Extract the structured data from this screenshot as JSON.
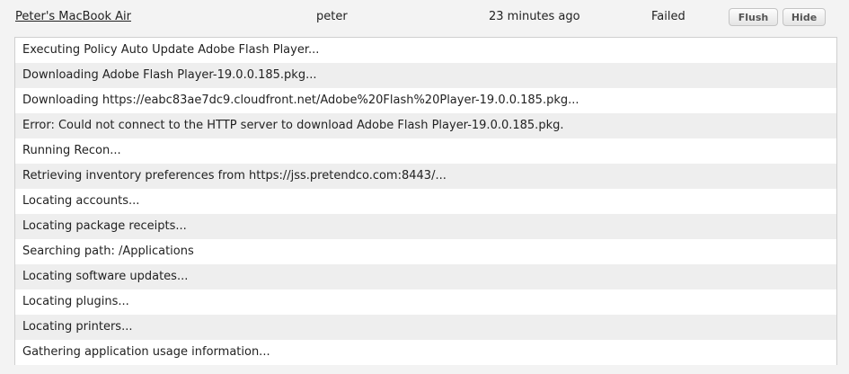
{
  "header": {
    "computer_name": "Peter's MacBook Air",
    "username": "peter",
    "time": "23 minutes ago",
    "status": "Failed",
    "flush_label": "Flush",
    "hide_label": "Hide"
  },
  "log": {
    "lines": [
      "Executing Policy Auto Update Adobe Flash Player...",
      "Downloading Adobe Flash Player-19.0.0.185.pkg...",
      "Downloading https://eabc83ae7dc9.cloudfront.net/Adobe%20Flash%20Player-19.0.0.185.pkg...",
      "Error: Could not connect to the HTTP server to download Adobe Flash Player-19.0.0.185.pkg.",
      "Running Recon...",
      "Retrieving inventory preferences from https://jss.pretendco.com:8443/...",
      "Locating accounts...",
      "Locating package receipts...",
      "Searching path: /Applications",
      "Locating software updates...",
      "Locating plugins...",
      "Locating printers...",
      "Gathering application usage information..."
    ]
  }
}
